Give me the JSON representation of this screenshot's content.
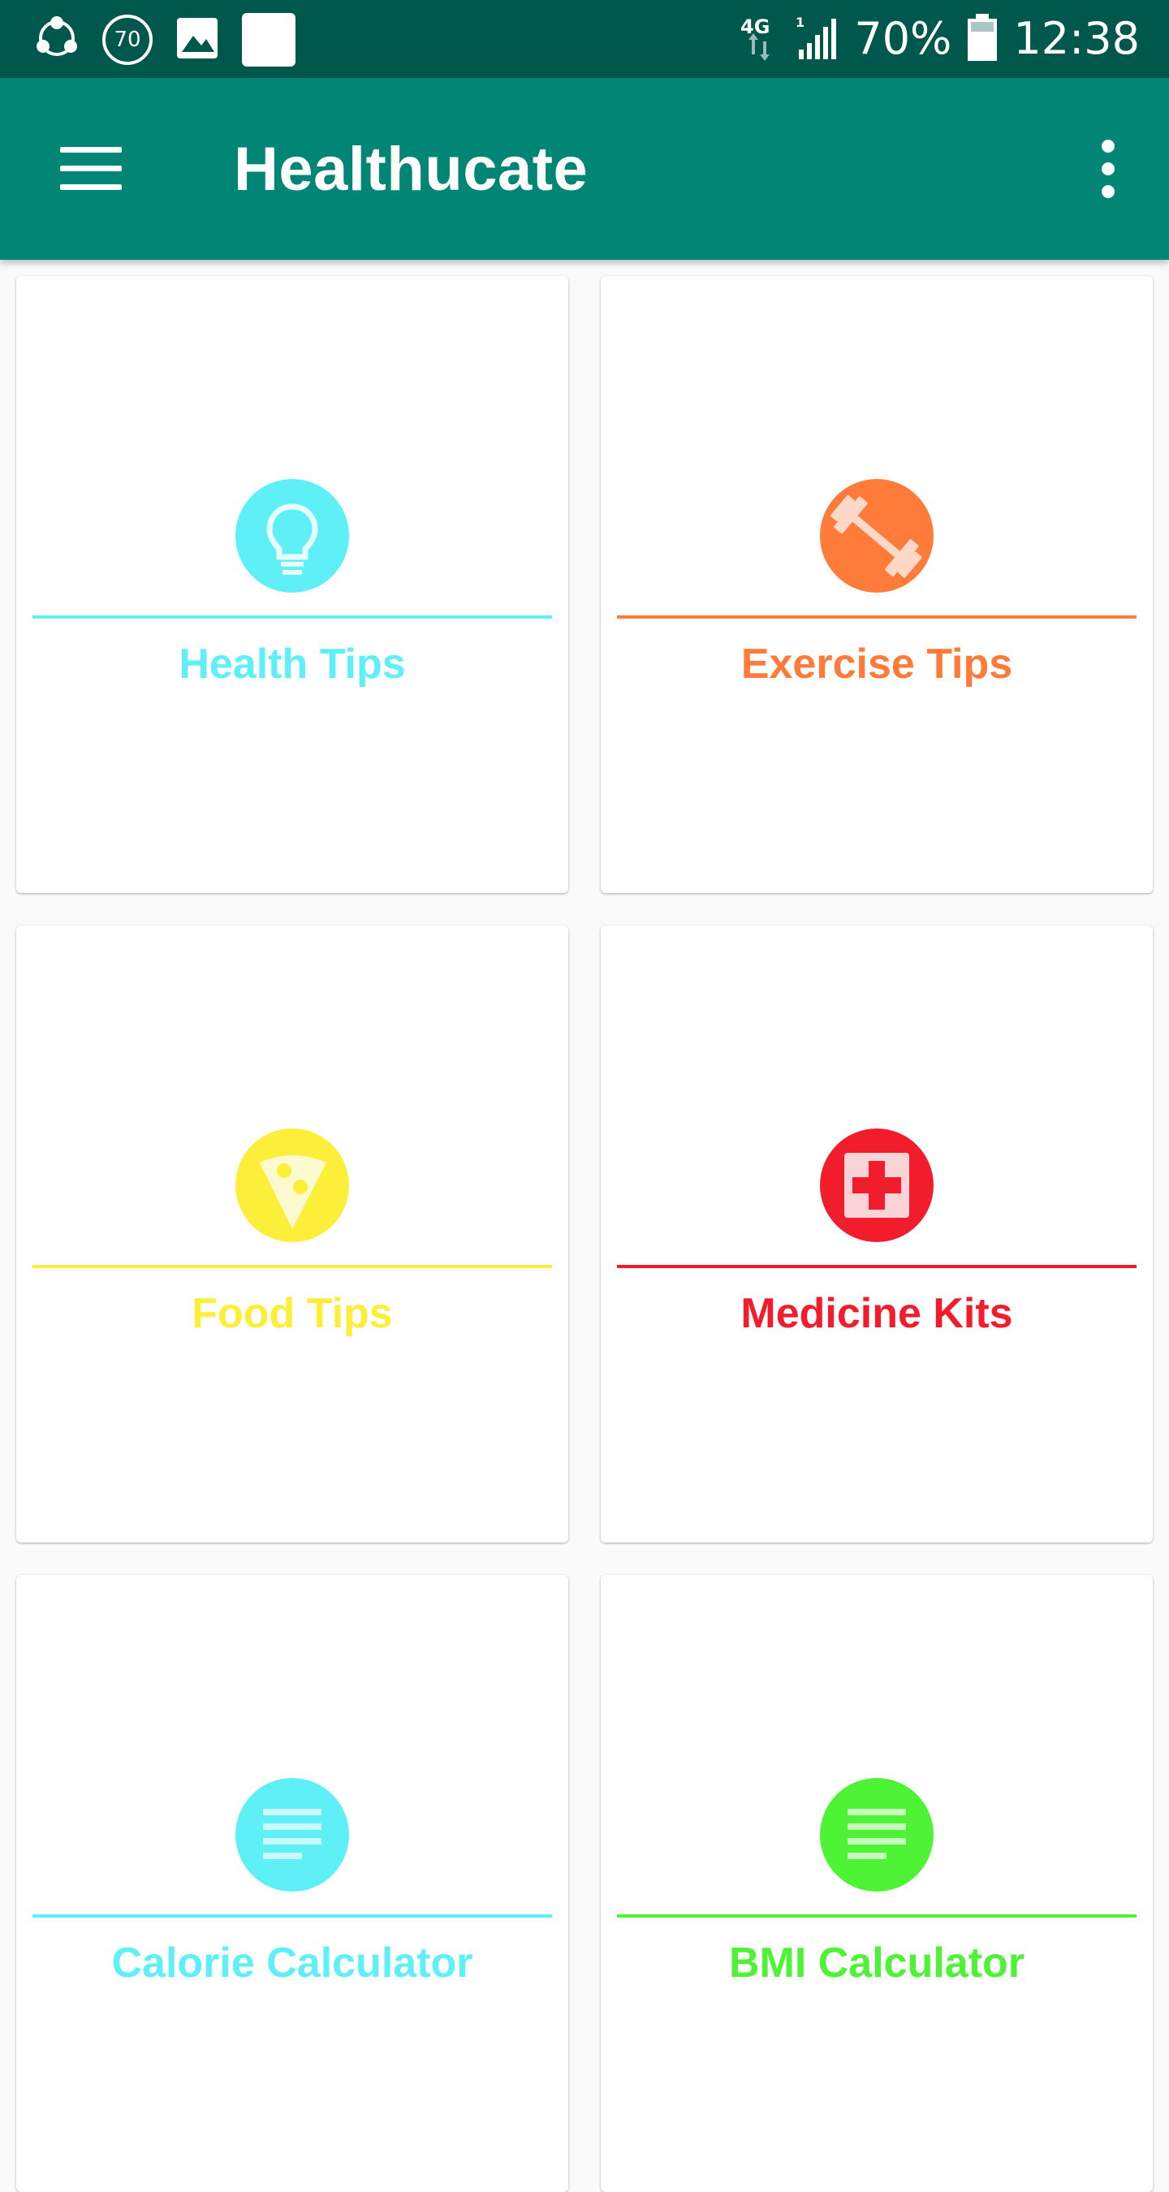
{
  "status_bar": {
    "battery_level": "70%",
    "time": "12:38",
    "network": "4G",
    "notification_badge": "70"
  },
  "app_bar": {
    "title": "Healthucate"
  },
  "tiles": [
    {
      "label": "Health Tips",
      "icon": "lightbulb-icon",
      "color": "#5ff0f7"
    },
    {
      "label": "Exercise Tips",
      "icon": "dumbbell-icon",
      "color": "#ff7b39"
    },
    {
      "label": "Food Tips",
      "icon": "pizza-slice-icon",
      "color": "#fdee3a"
    },
    {
      "label": "Medicine Kits",
      "icon": "medical-cross-icon",
      "color": "#f21d2c"
    },
    {
      "label": "Calorie Calculator",
      "icon": "list-lines-icon",
      "color": "#5ff0f7"
    },
    {
      "label": "BMI Calculator",
      "icon": "list-lines-icon",
      "color": "#4ff336"
    }
  ]
}
